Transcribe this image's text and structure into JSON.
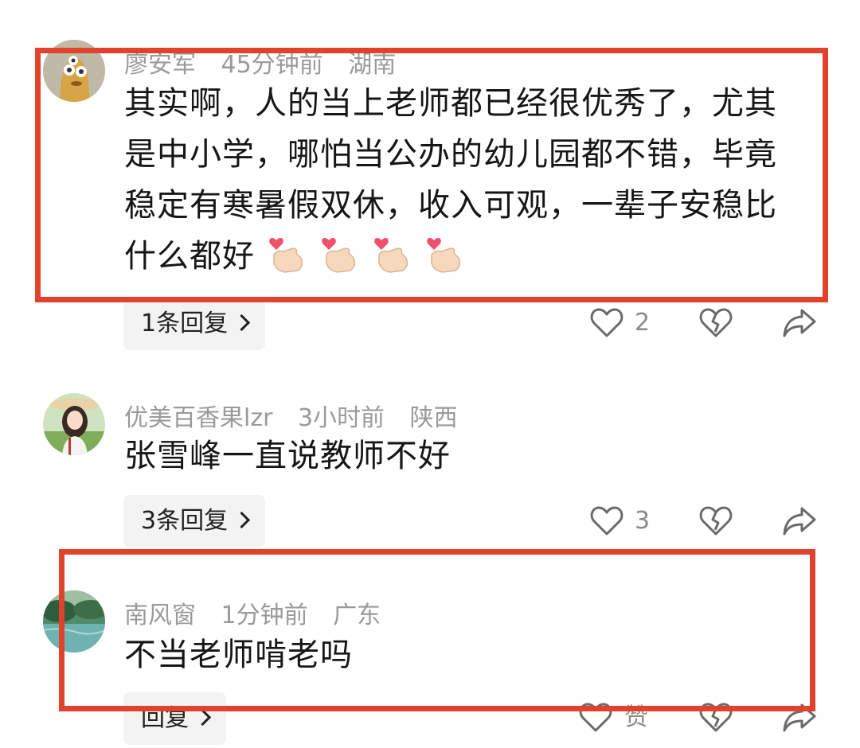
{
  "comments": [
    {
      "author": "廖安军",
      "time": "45分钟前",
      "location": "湖南",
      "text": "其实啊，人的当上老师都已经很优秀了，尤其是中小学，哪怕当公办的幼儿园都不错，毕竟稳定有寒暑假双休，收入可观，一辈子安稳比什么都好",
      "reply_label": "1条回复",
      "like_count": "2"
    },
    {
      "author": "优美百香果lzr",
      "time": "3小时前",
      "location": "陕西",
      "text": "张雪峰一直说教师不好",
      "reply_label": "3条回复",
      "like_count": "3"
    },
    {
      "author": "南风窗",
      "time": "1分钟前",
      "location": "广东",
      "text": "不当老师啃老吗",
      "reply_label": "回复",
      "like_count": "赞"
    }
  ],
  "emoji_icons": [
    "finger-heart-icon",
    "finger-heart-icon",
    "finger-heart-icon",
    "finger-heart-icon"
  ],
  "highlight_color": "#e0422c"
}
